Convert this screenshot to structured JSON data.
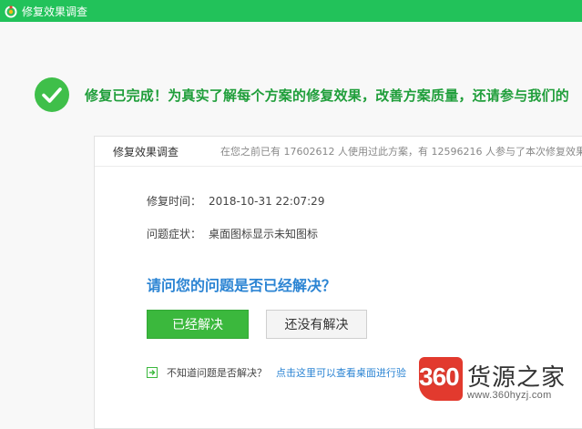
{
  "window": {
    "title": "修复效果调查"
  },
  "banner": {
    "message": "修复已完成！为真实了解每个方案的修复效果，改善方案质量，还请参与我们的"
  },
  "panel": {
    "title": "修复效果调查",
    "stats": "在您之前已有 17602612 人使用过此方案，有 12596216 人参与了本次修复效果",
    "fields": [
      {
        "label": "修复时间：",
        "value": "2018-10-31 22:07:29"
      },
      {
        "label": "问题症状：",
        "value": "桌面图标显示未知图标"
      }
    ],
    "question": "请问您的问题是否已经解决？",
    "buttons": {
      "resolved": "已经解决",
      "unresolved": "还没有解决"
    },
    "help": {
      "label": "不知道问题是否解决？",
      "link": "点击这里可以查看桌面进行验"
    }
  },
  "watermark": {
    "logo": "360",
    "name": "货源之家",
    "url": "www.360hyzj.com"
  },
  "colors": {
    "titlebar": "#22c25a",
    "success": "#3fbf4a",
    "accent_text": "#1f9e3a",
    "link": "#2b84d3",
    "primary_button": "#3bb83d"
  }
}
